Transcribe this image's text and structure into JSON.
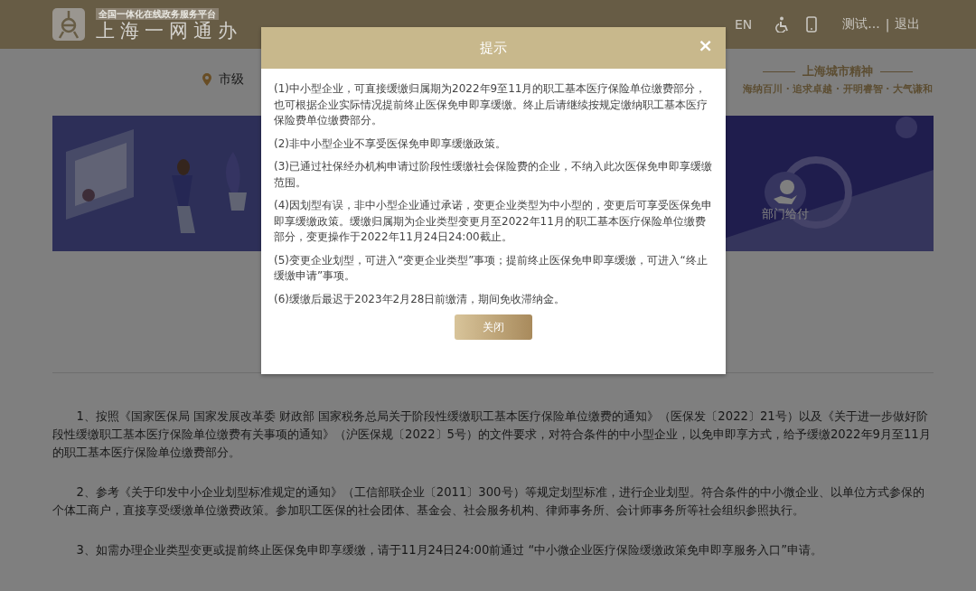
{
  "header": {
    "tagline": "全国一体化在线政务服务平台",
    "title": "上海一网通办",
    "language": "EN",
    "user": "测试...",
    "separator": "|",
    "logout": "退出"
  },
  "location": {
    "label": "市级"
  },
  "spirit": {
    "title": "上海城市精神",
    "motto": "海纳百川 · 追求卓越 · 开明睿智 · 大气谦和"
  },
  "banner": {
    "kind": "picture",
    "service_label": "部门给付"
  },
  "paragraphs": [
    "1、按照《国家医保局 国家发展改革委 财政部 国家税务总局关于阶段性缓缴职工基本医疗保险单位缴费的通知》（医保发〔2022〕21号）以及《关于进一步做好阶段性缓缴职工基本医疗保险单位缴费有关事项的通知》（沪医保规〔2022〕5号）的文件要求，对符合条件的中小型企业，以免申即享方式，给予缓缴2022年9月至11月的职工基本医疗保险单位缴费部分。",
    "2、参考《关于印发中小企业划型标准规定的通知》（工信部联企业〔2011〕300号）等规定划型标准，进行企业划型。符合条件的中小微企业、以单位方式参保的个体工商户，直接享受缓缴单位缴费政策。参加职工医保的社会团体、基金会、社会服务机构、律师事务所、会计师事务所等社会组织参照执行。",
    "3、如需办理企业类型变更或提前终止医保免申即享缓缴，请于11月24日24:00前通过 “中小微企业医疗保险缓缴政策免申即享服务入口”申请。"
  ],
  "dialog": {
    "title": "提示",
    "close": "×",
    "items": [
      "(1)中小型企业，可直接缓缴归属期为2022年9至11月的职工基本医疗保险单位缴费部分，也可根据企业实际情况提前终止医保免申即享缓缴。终止后请继续按规定缴纳职工基本医疗保险费单位缴费部分。",
      "(2)非中小型企业不享受医保免申即享缓缴政策。",
      "(3)已通过社保经办机构申请过阶段性缓缴社会保险费的企业，不纳入此次医保免申即享缓缴范围。",
      "(4)因划型有误，非中小型企业通过承诺，变更企业类型为中小型的，变更后可享受医保免申即享缓缴政策。缓缴归属期为企业类型变更月至2022年11月的职工基本医疗保险单位缴费部分，变更操作于2022年11月24日24:00截止。",
      "(5)变更企业划型，可进入“变更企业类型”事项；提前终止医保免申即享缓缴，可进入“终止缓缴申请”事项。",
      "(6)缓缴后最迟于2023年2月28日前缴清，期间免收滞纳金。"
    ],
    "button": "关闭"
  }
}
